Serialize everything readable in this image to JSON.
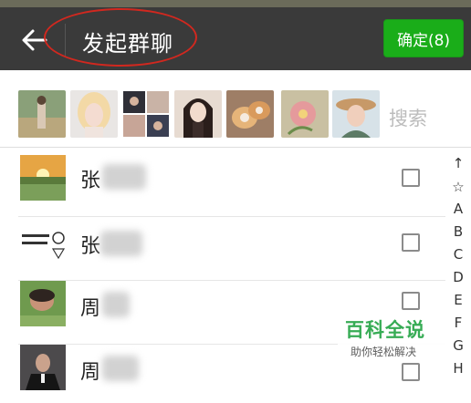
{
  "header": {
    "title": "发起群聊",
    "confirm_label": "确定(8)"
  },
  "avatar_bar": {
    "search_placeholder": "搜索",
    "selected_avatars": [
      "avatar-person-field",
      "avatar-blonde-woman",
      "avatar-collage",
      "avatar-anime-girl",
      "avatar-dogs",
      "avatar-flower",
      "avatar-woman-hat"
    ]
  },
  "contacts": [
    {
      "name_visible": "张",
      "thumb": "sunset-landscape",
      "checked": false
    },
    {
      "name_visible": "张",
      "thumb": "cartoon-text-image",
      "checked": false
    },
    {
      "name_visible": "周",
      "thumb": "person-lying-grass",
      "checked": false
    },
    {
      "name_visible": "周",
      "thumb": "man-dark-suit",
      "checked": false
    }
  ],
  "index_letters": [
    "↑",
    "☆",
    "A",
    "B",
    "C",
    "D",
    "E",
    "F",
    "G",
    "H"
  ],
  "watermark": {
    "title": "百科全说",
    "subtitle": "助你轻松解决"
  },
  "colors": {
    "header_bg": "#3a3a3a",
    "confirm_bg": "#1aad19",
    "annotation_ellipse": "#d1281f",
    "watermark_green": "#2da84c"
  }
}
